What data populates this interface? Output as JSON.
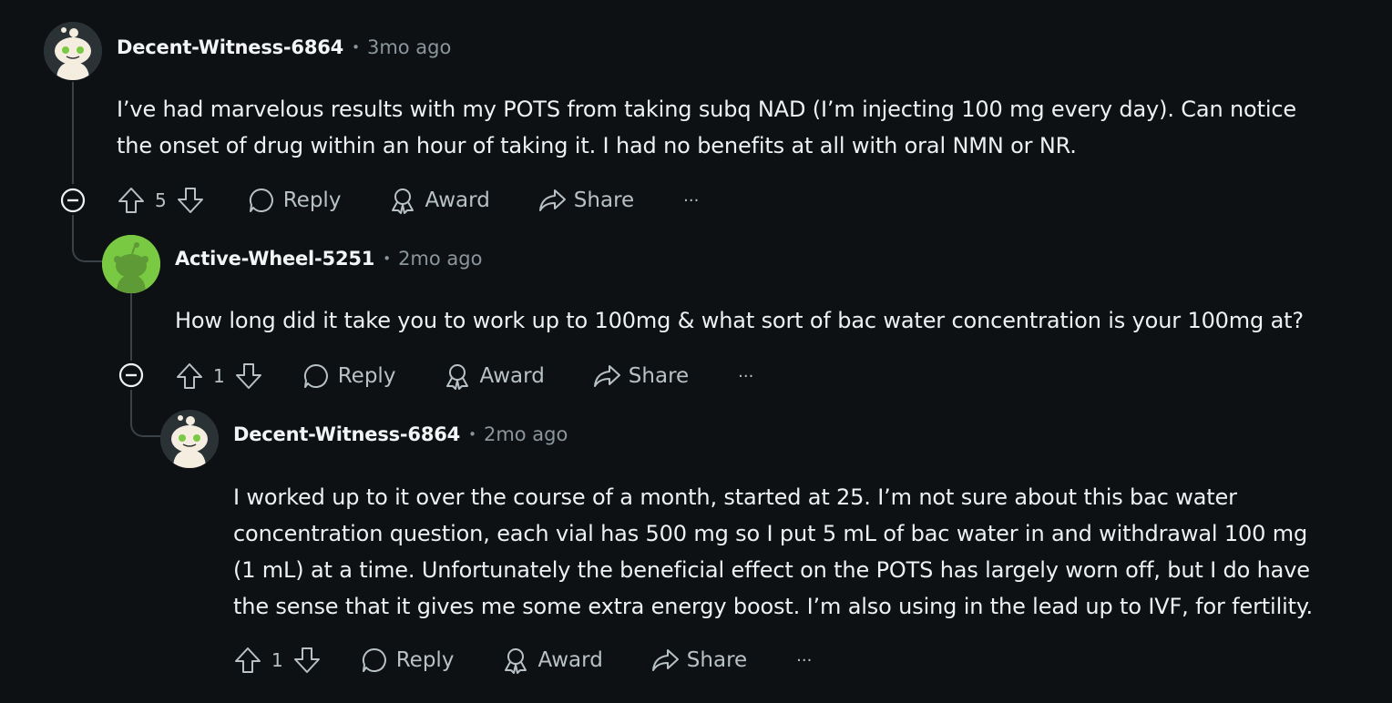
{
  "comments": [
    {
      "username": "Decent-Witness-6864",
      "separator": "•",
      "time": "3mo ago",
      "lines": [
        "I’ve had marvelous results with my POTS from taking subq NAD (I’m injecting 100 mg every day). Can notice",
        "the onset of drug within an hour of taking it. I had no benefits at all with oral NMN or NR."
      ],
      "votes": "5",
      "reply_label": "Reply",
      "award_label": "Award",
      "share_label": "Share",
      "more_label": "···"
    },
    {
      "username": "Active-Wheel-5251",
      "separator": "•",
      "time": "2mo ago",
      "lines": [
        "How long did it take you to work up to 100mg & what sort of bac water concentration is your 100mg at?"
      ],
      "votes": "1",
      "reply_label": "Reply",
      "award_label": "Award",
      "share_label": "Share",
      "more_label": "···"
    },
    {
      "username": "Decent-Witness-6864",
      "separator": "•",
      "time": "2mo ago",
      "lines": [
        "I worked up to it over the course of a month, started at 25. I’m not sure about this bac water",
        "concentration question, each vial has 500 mg so I put 5 mL of bac water in and withdrawal 100 mg",
        "(1 mL) at a time. Unfortunately the beneficial effect on the POTS has largely worn off, but I do have",
        "the sense that it gives me some extra energy boost. I’m also using in the lead up to IVF, for fertility."
      ],
      "votes": "1",
      "reply_label": "Reply",
      "award_label": "Award",
      "share_label": "Share",
      "more_label": "···"
    }
  ],
  "icons": {
    "upvote": "upvote-icon",
    "downvote": "downvote-icon",
    "reply": "speech-bubble-icon",
    "award": "award-ribbon-icon",
    "share": "share-arrow-icon",
    "collapse": "collapse-minus-icon",
    "avatar_default": "snoo-avatar-icon"
  },
  "colors": {
    "background": "#0e1113",
    "text": "#eef1f3",
    "meta": "#8a969c",
    "action": "#b7c1c6",
    "thread_line": "#3a4248",
    "avatar_green": "#7ac943"
  }
}
